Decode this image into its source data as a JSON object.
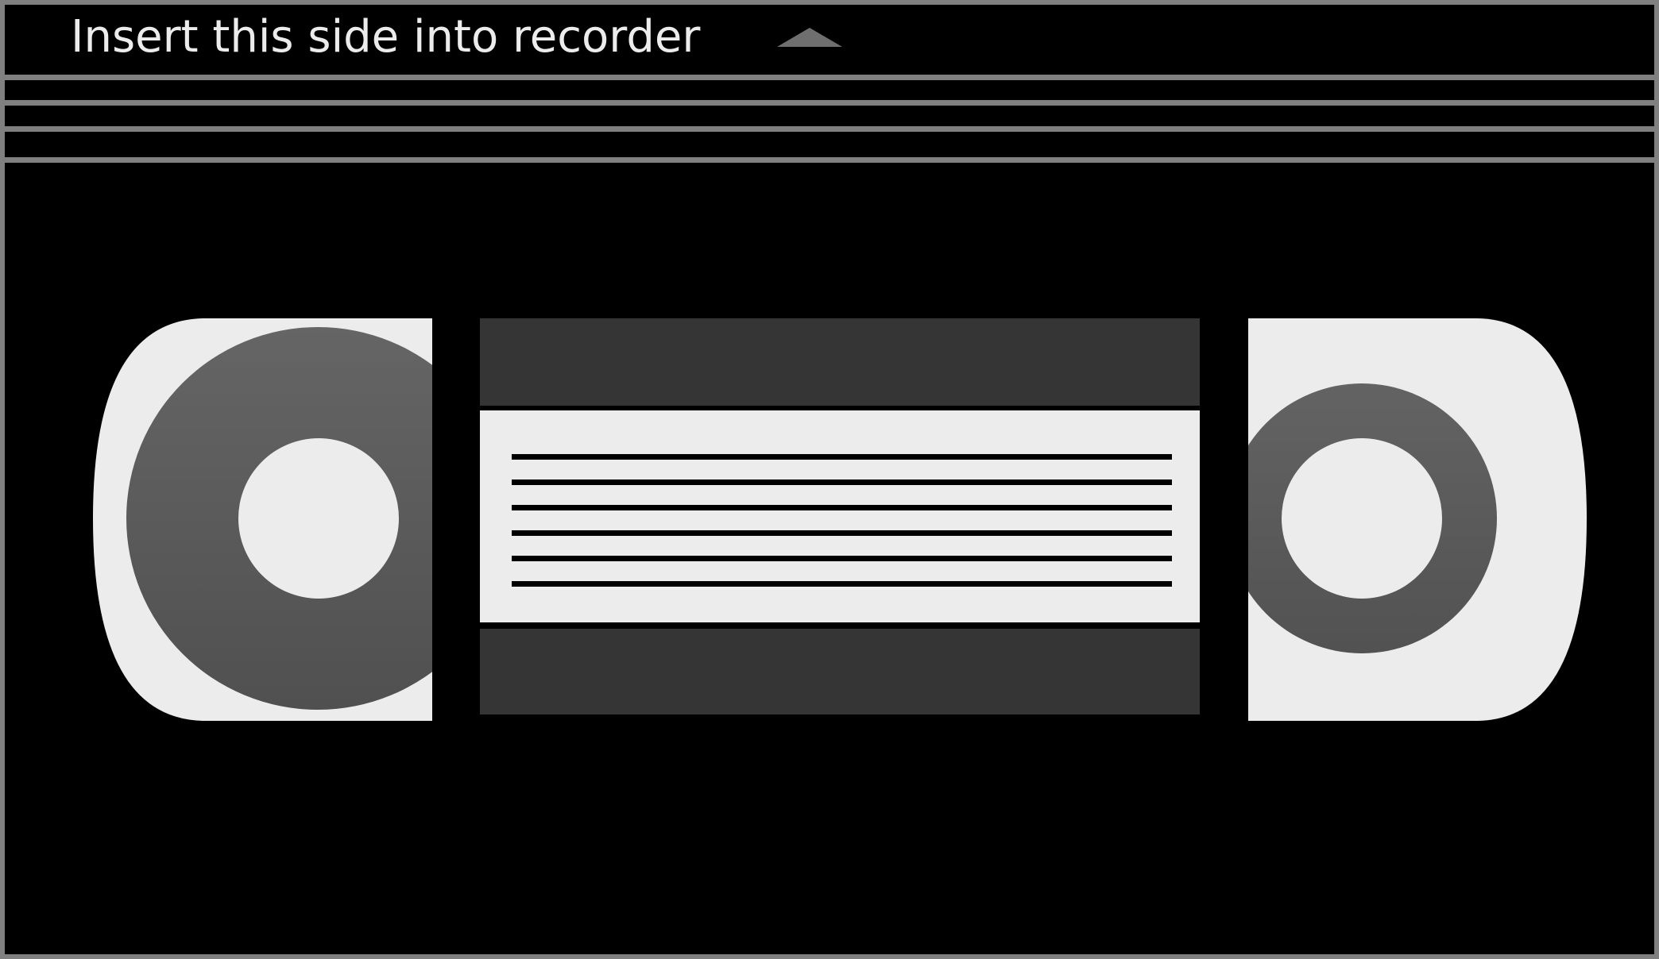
{
  "instruction_label": "Insert this side into recorder",
  "icons": {
    "direction_arrow": "arrow-up-icon"
  },
  "colors": {
    "background": "#000000",
    "frame": "#808080",
    "shell_light": "#ececec",
    "reel_dark": "#555555",
    "window_dark": "#353535",
    "arrow": "#6f6f6f",
    "text": "#ececec"
  },
  "left_reel": {
    "tape_fill": "large"
  },
  "right_reel": {
    "tape_fill": "small"
  },
  "label_area": {
    "ruled_lines": 6
  }
}
